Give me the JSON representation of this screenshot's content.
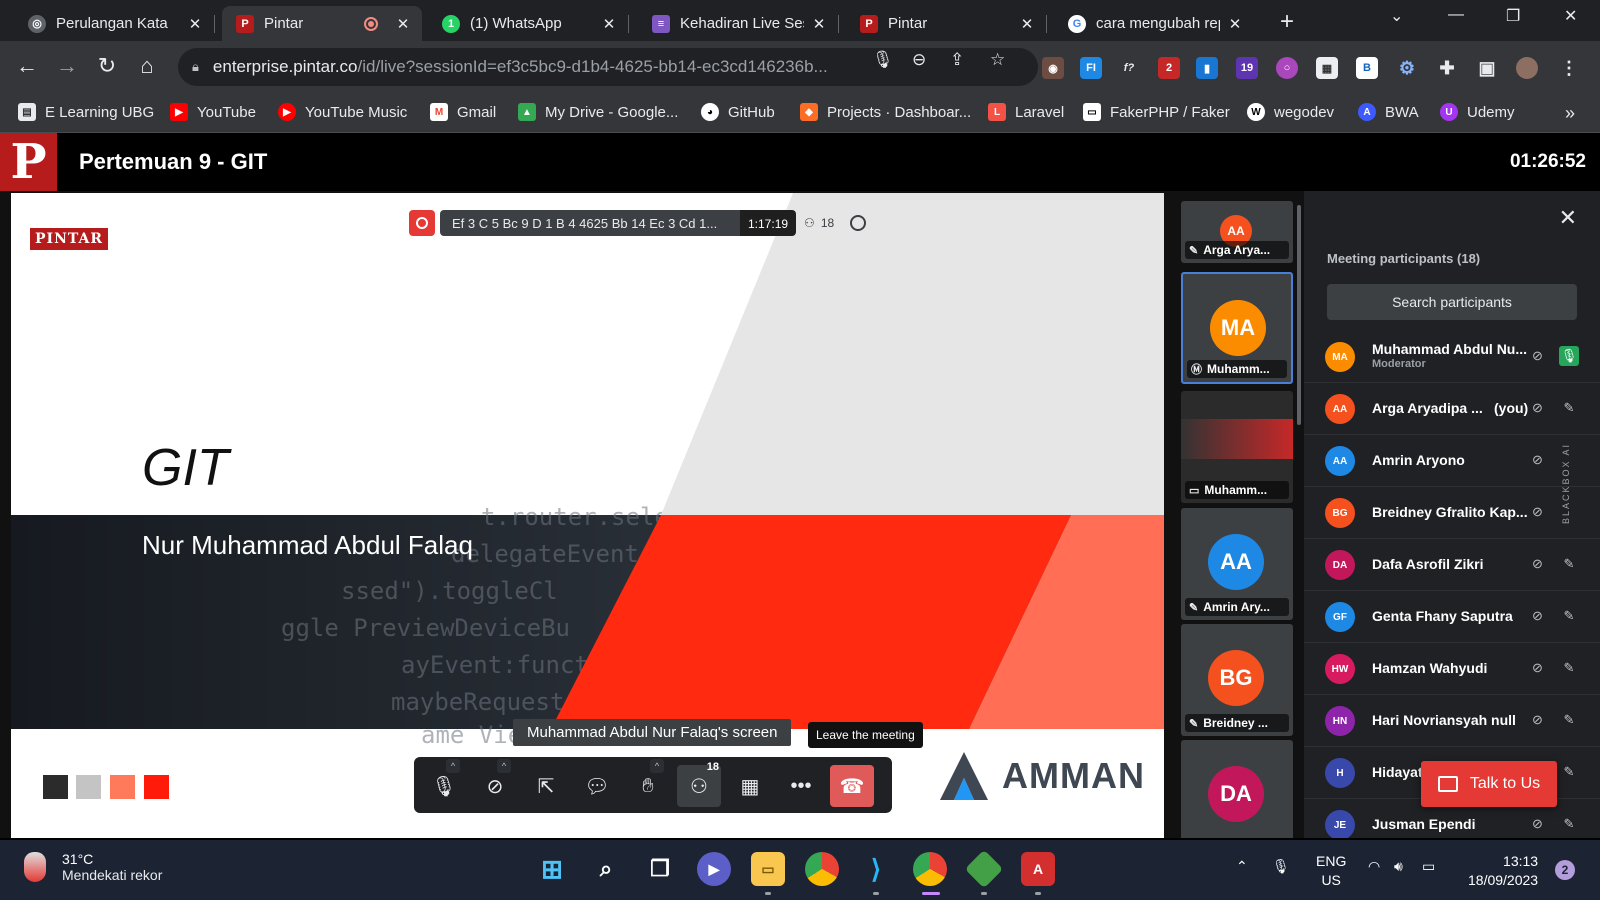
{
  "browser": {
    "tabs": [
      {
        "title": "Perulangan Kata",
        "icon": "globe-icon",
        "color": "#9aa0a6"
      },
      {
        "title": "Pintar",
        "icon": "pintar-icon",
        "color": "#b71c1c",
        "recording": true
      },
      {
        "title": "(1) WhatsApp",
        "icon": "whatsapp-icon",
        "color": "#25d366"
      },
      {
        "title": "Kehadiran Live Sess",
        "icon": "forms-icon",
        "color": "#7e57c2"
      },
      {
        "title": "Pintar",
        "icon": "pintar-icon",
        "color": "#b71c1c"
      },
      {
        "title": "cara mengubah rep",
        "icon": "google-icon",
        "color": "#ffffff"
      }
    ],
    "address": {
      "host": "enterprise.pintar.co",
      "path": "/id/live?sessionId=ef3c5bc9-d1b4-4625-bb14-ec3cd146236b..."
    },
    "extension_badges": [
      "2",
      "19"
    ],
    "bookmarks": [
      {
        "label": "E Learning UBG",
        "color": "#e8eaed"
      },
      {
        "label": "YouTube",
        "color": "#ff0000"
      },
      {
        "label": "YouTube Music",
        "color": "#ff0000"
      },
      {
        "label": "Gmail",
        "color": "#ea4335"
      },
      {
        "label": "My Drive - Google...",
        "color": "#fbbc04"
      },
      {
        "label": "GitHub",
        "color": "#ffffff"
      },
      {
        "label": "Projects · Dashboar...",
        "color": "#fc6d26"
      },
      {
        "label": "Laravel",
        "color": "#f55247"
      },
      {
        "label": "FakerPHP / Faker",
        "color": "#ffffff"
      },
      {
        "label": "wegodev",
        "color": "#ffffff"
      },
      {
        "label": "BWA",
        "color": "#3d5afe"
      },
      {
        "label": "Udemy",
        "color": "#a435f0"
      }
    ]
  },
  "app": {
    "logo_letter": "P",
    "title": "Pertemuan 9 - GIT",
    "elapsed": "01:26:52"
  },
  "recording": {
    "session": "Ef 3 C 5 Bc 9 D 1 B 4 4625 Bb 14 Ec 3 Cd 1...",
    "timer": "1:17:19",
    "participants": "18"
  },
  "slide": {
    "brand": "PINTAR",
    "title": "GIT",
    "author": "Nur Muhammad Abdul Falaq",
    "sponsor": "AMMAN",
    "code_lines": [
      "t.router.sele",
      "delegateEvent",
      "ssed\").toggleCl",
      "ggle PreviewDeviceBu",
      "ayEvent:functi",
      "maybeRequest",
      "ame View"
    ],
    "swatches": [
      "#2b2b2b",
      "#c4c4c4",
      "#ff7a5a",
      "#ff1a0a"
    ]
  },
  "share_label": "Muhammad Abdul Nur Falaq's screen",
  "tooltip": "Leave the meeting",
  "controls": {
    "participants_count": "18"
  },
  "filmstrip": [
    {
      "initials": "AA",
      "name": "Arga Arya...",
      "color": "#f4511e"
    },
    {
      "initials": "MA",
      "name": "Muhamm...",
      "color": "#fb8c00",
      "speaking": true
    },
    {
      "initials": "",
      "name": "Muhamm...",
      "color": "#222222"
    },
    {
      "initials": "AA",
      "name": "Amrin Ary...",
      "color": "#1e88e5"
    },
    {
      "initials": "BG",
      "name": "Breidney ...",
      "color": "#f4511e"
    },
    {
      "initials": "DA",
      "name": "",
      "color": "#c2185b"
    }
  ],
  "panel": {
    "title": "Meeting participants (18)",
    "search_placeholder": "Search participants",
    "you_label": "(you)",
    "talk_label": "Talk to Us",
    "side_label": "BLACKBOX AI",
    "participants": [
      {
        "initials": "MA",
        "name": "Muhammad Abdul Nu...",
        "role": "Moderator",
        "color": "#fb8c00",
        "mic_on": true
      },
      {
        "initials": "AA",
        "name": "Arga Aryadipa ...",
        "color": "#f4511e",
        "you": true
      },
      {
        "initials": "AA",
        "name": "Amrin Aryono",
        "color": "#1e88e5"
      },
      {
        "initials": "BG",
        "name": "Breidney Gfralito Kap...",
        "color": "#f4511e"
      },
      {
        "initials": "DA",
        "name": "Dafa Asrofil Zikri",
        "color": "#c2185b"
      },
      {
        "initials": "GF",
        "name": "Genta Fhany Saputra",
        "color": "#1e88e5"
      },
      {
        "initials": "HW",
        "name": "Hamzan Wahyudi",
        "color": "#d81b60"
      },
      {
        "initials": "HN",
        "name": "Hari Novriansyah null",
        "color": "#8e24aa"
      },
      {
        "initials": "H",
        "name": "Hidayatu",
        "color": "#3949ab"
      },
      {
        "initials": "JE",
        "name": "Jusman Ependi",
        "color": "#3949ab"
      }
    ]
  },
  "taskbar": {
    "temp": "31°C",
    "weather": "Mendekati rekor",
    "lang": "ENG",
    "region": "US",
    "time": "13:13",
    "date": "18/09/2023",
    "notifications": "2"
  }
}
